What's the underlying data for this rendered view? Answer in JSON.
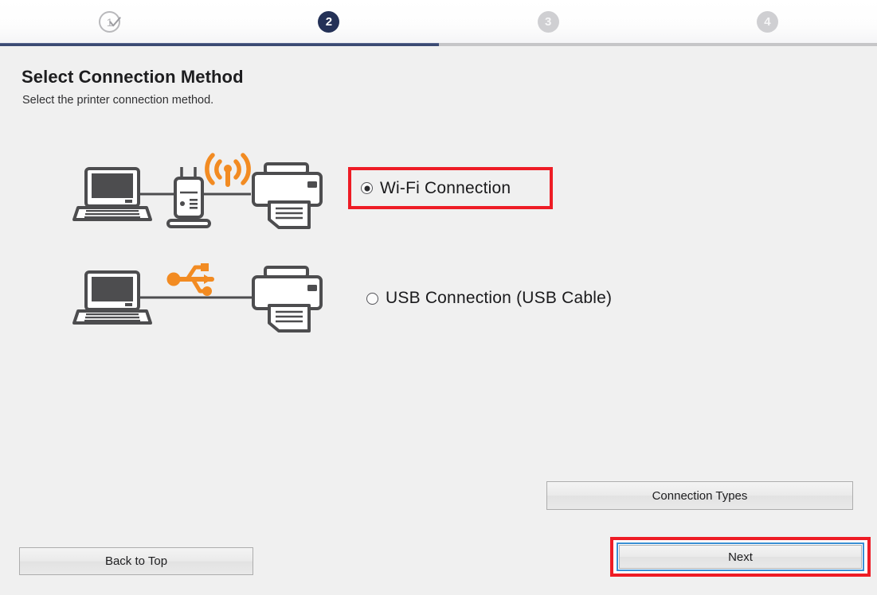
{
  "wizard": {
    "steps": [
      {
        "number": "1",
        "state": "done",
        "icon": "check-icon"
      },
      {
        "number": "2",
        "state": "active",
        "icon": ""
      },
      {
        "number": "3",
        "state": "upcoming",
        "icon": ""
      },
      {
        "number": "4",
        "state": "upcoming",
        "icon": ""
      }
    ],
    "progress_percent": 50,
    "active_color": "#243157",
    "track_filled_color": "#3b4a72",
    "track_empty_color": "#c6c6c8"
  },
  "page": {
    "title": "Select Connection Method",
    "subtitle": "Select the printer connection method."
  },
  "options": [
    {
      "id": "wifi",
      "label": "Wi-Fi Connection",
      "selected": true,
      "highlighted": true,
      "illustration": "laptop-router-wifi-printer-illustration",
      "accent_color": "#f28b22"
    },
    {
      "id": "usb",
      "label": "USB Connection (USB Cable)",
      "selected": false,
      "highlighted": false,
      "illustration": "laptop-usb-cable-printer-illustration",
      "accent_color": "#f28b22"
    }
  ],
  "buttons": {
    "connection_types": "Connection Types",
    "back_to_top": "Back to Top",
    "next": "Next"
  },
  "colors": {
    "highlight_box": "#ee1c25",
    "focus_ring": "#3a8fd4",
    "background": "#f0f0f0",
    "orange": "#f28b22",
    "device_gray": "#4d4d4f"
  }
}
